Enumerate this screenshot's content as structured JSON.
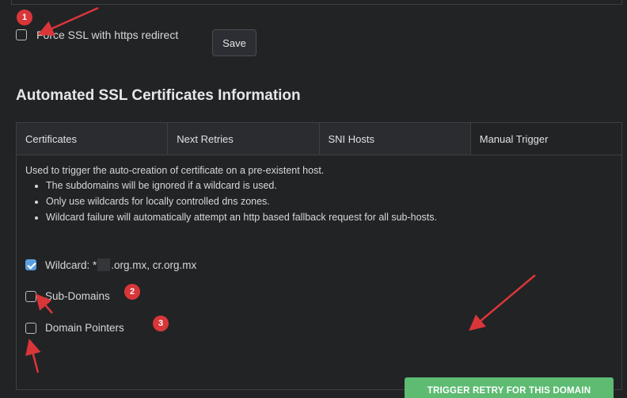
{
  "force_ssl": {
    "label": "Force SSL with https redirect",
    "checked": false,
    "save_label": "Save"
  },
  "section": {
    "title": "Automated SSL Certificates Information"
  },
  "tabs": [
    {
      "label": "Certificates",
      "active": false
    },
    {
      "label": "Next Retries",
      "active": false
    },
    {
      "label": "SNI Hosts",
      "active": false
    },
    {
      "label": "Manual Trigger",
      "active": true
    }
  ],
  "manual_trigger": {
    "intro": "Used to trigger the auto-creation of certificate on a pre-existent host.",
    "bullets": [
      "The subdomains will be ignored if a wildcard is used.",
      "Only use wildcards for locally controlled dns zones.",
      "Wildcard failure will automatically attempt an http based fallback request for all sub-hosts."
    ],
    "options": {
      "wildcard": {
        "label_prefix": "Wildcard: *",
        "label_suffix": ".org.mx, cr.org.mx",
        "checked": true
      },
      "subdomains": {
        "label": "Sub-Domains",
        "checked": false
      },
      "pointers": {
        "label": "Domain Pointers",
        "checked": false
      }
    },
    "trigger_label": "TRIGGER RETRY FOR THIS DOMAIN"
  },
  "annotations": {
    "badge_1": "1",
    "badge_2": "2",
    "badge_3": "3"
  },
  "colors": {
    "background": "#222325",
    "accent_check": "#5a9fe0",
    "trigger_button": "#5dbb72",
    "annotation_red": "#d9363a"
  }
}
